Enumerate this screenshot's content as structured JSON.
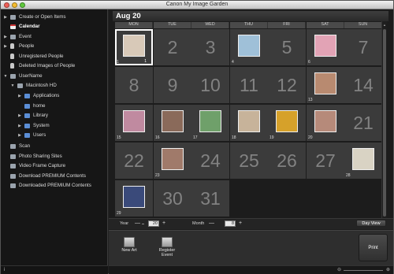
{
  "window": {
    "title": "Canon My Image Garden"
  },
  "sidebar": {
    "items": [
      {
        "label": "Create or Open Items",
        "arrow": "▶",
        "icon": "create-items-icon",
        "level": 0
      },
      {
        "label": "Calendar",
        "arrow": "",
        "icon": "calendar-icon",
        "level": 0,
        "selected": true
      },
      {
        "label": "Event",
        "arrow": "▶",
        "icon": "event-icon",
        "level": 0
      },
      {
        "label": "People",
        "arrow": "▶",
        "icon": "people-icon",
        "level": 0
      },
      {
        "label": "Unregistered People",
        "arrow": "",
        "icon": "unregistered-people-icon",
        "level": 0
      },
      {
        "label": "Deleted Images of People",
        "arrow": "",
        "icon": "deleted-people-icon",
        "level": 0
      },
      {
        "label": "UserName",
        "arrow": "▼",
        "icon": "computer-icon",
        "level": 0
      },
      {
        "label": "Macintosh HD",
        "arrow": "▼",
        "icon": "hard-drive-icon",
        "level": 1
      },
      {
        "label": "Applications",
        "arrow": "▶",
        "icon": "folder-icon",
        "level": 2
      },
      {
        "label": "home",
        "arrow": "",
        "icon": "folder-icon",
        "level": 2
      },
      {
        "label": "Library",
        "arrow": "▶",
        "icon": "folder-icon",
        "level": 2
      },
      {
        "label": "System",
        "arrow": "▶",
        "icon": "folder-icon",
        "level": 2
      },
      {
        "label": "Users",
        "arrow": "▶",
        "icon": "folder-icon",
        "level": 2
      },
      {
        "label": "Scan",
        "arrow": "",
        "icon": "scan-icon",
        "level": 0
      },
      {
        "label": "Photo Sharing Sites",
        "arrow": "",
        "icon": "photo-sharing-icon",
        "level": 0
      },
      {
        "label": "Video Frame Capture",
        "arrow": "",
        "icon": "video-frame-icon",
        "level": 0
      },
      {
        "label": "Download PREMIUM Contents",
        "arrow": "",
        "icon": "download-premium-icon",
        "level": 0
      },
      {
        "label": "Downloaded PREMIUM Contents",
        "arrow": "",
        "icon": "downloaded-premium-icon",
        "level": 0
      }
    ],
    "footer_label": "i"
  },
  "calendar": {
    "month_title": "Aug 20",
    "weekdays": [
      "MON",
      "TUE",
      "WED",
      "THU",
      "FRI",
      "SAT",
      "SUN"
    ],
    "days": [
      {
        "n": "1",
        "photo": true,
        "badge": "1",
        "selected": true,
        "palette": "#d8c9b8"
      },
      {
        "n": "2"
      },
      {
        "n": "3"
      },
      {
        "n": "4",
        "photo": true,
        "palette": "#9fc0d8"
      },
      {
        "n": "5"
      },
      {
        "n": "6",
        "photo": true,
        "palette": "#e2a3b5"
      },
      {
        "n": "7"
      },
      {
        "n": "8"
      },
      {
        "n": "9"
      },
      {
        "n": "10"
      },
      {
        "n": "11"
      },
      {
        "n": "12"
      },
      {
        "n": "13",
        "photo": true,
        "palette": "#b88a70"
      },
      {
        "n": "14"
      },
      {
        "n": "15",
        "photo": true,
        "palette": "#c08aa0"
      },
      {
        "n": "16",
        "photo": true,
        "palette": "#8a6a5a"
      },
      {
        "n": "17",
        "photo": true,
        "palette": "#6fa06a"
      },
      {
        "n": "18",
        "photo": true,
        "palette": "#c7b39a"
      },
      {
        "n": "19",
        "photo": true,
        "palette": "#d6a12a"
      },
      {
        "n": "20",
        "photo": true,
        "palette": "#b68a7a"
      },
      {
        "n": "21"
      },
      {
        "n": "22"
      },
      {
        "n": "23",
        "photo": true,
        "palette": "#a07a6a"
      },
      {
        "n": "24"
      },
      {
        "n": "25"
      },
      {
        "n": "26"
      },
      {
        "n": "27"
      },
      {
        "n": "28",
        "photo": true,
        "palette": "#d9d3c4"
      },
      {
        "n": "29",
        "photo": true,
        "palette": "#3a4a7a"
      },
      {
        "n": "30"
      },
      {
        "n": "31"
      }
    ]
  },
  "controls": {
    "year_label": "Year",
    "year_value": "20",
    "month_label": "Month",
    "month_value": "8",
    "minus": "—",
    "plus": "+",
    "day_view_label": "Day View"
  },
  "toolbar": {
    "new_art_label": "New Art",
    "register_event_label": "Register Event",
    "print_label": "Print"
  },
  "colors": {
    "accent_red": "#c33",
    "cell_bg": "#3b3b3b"
  }
}
